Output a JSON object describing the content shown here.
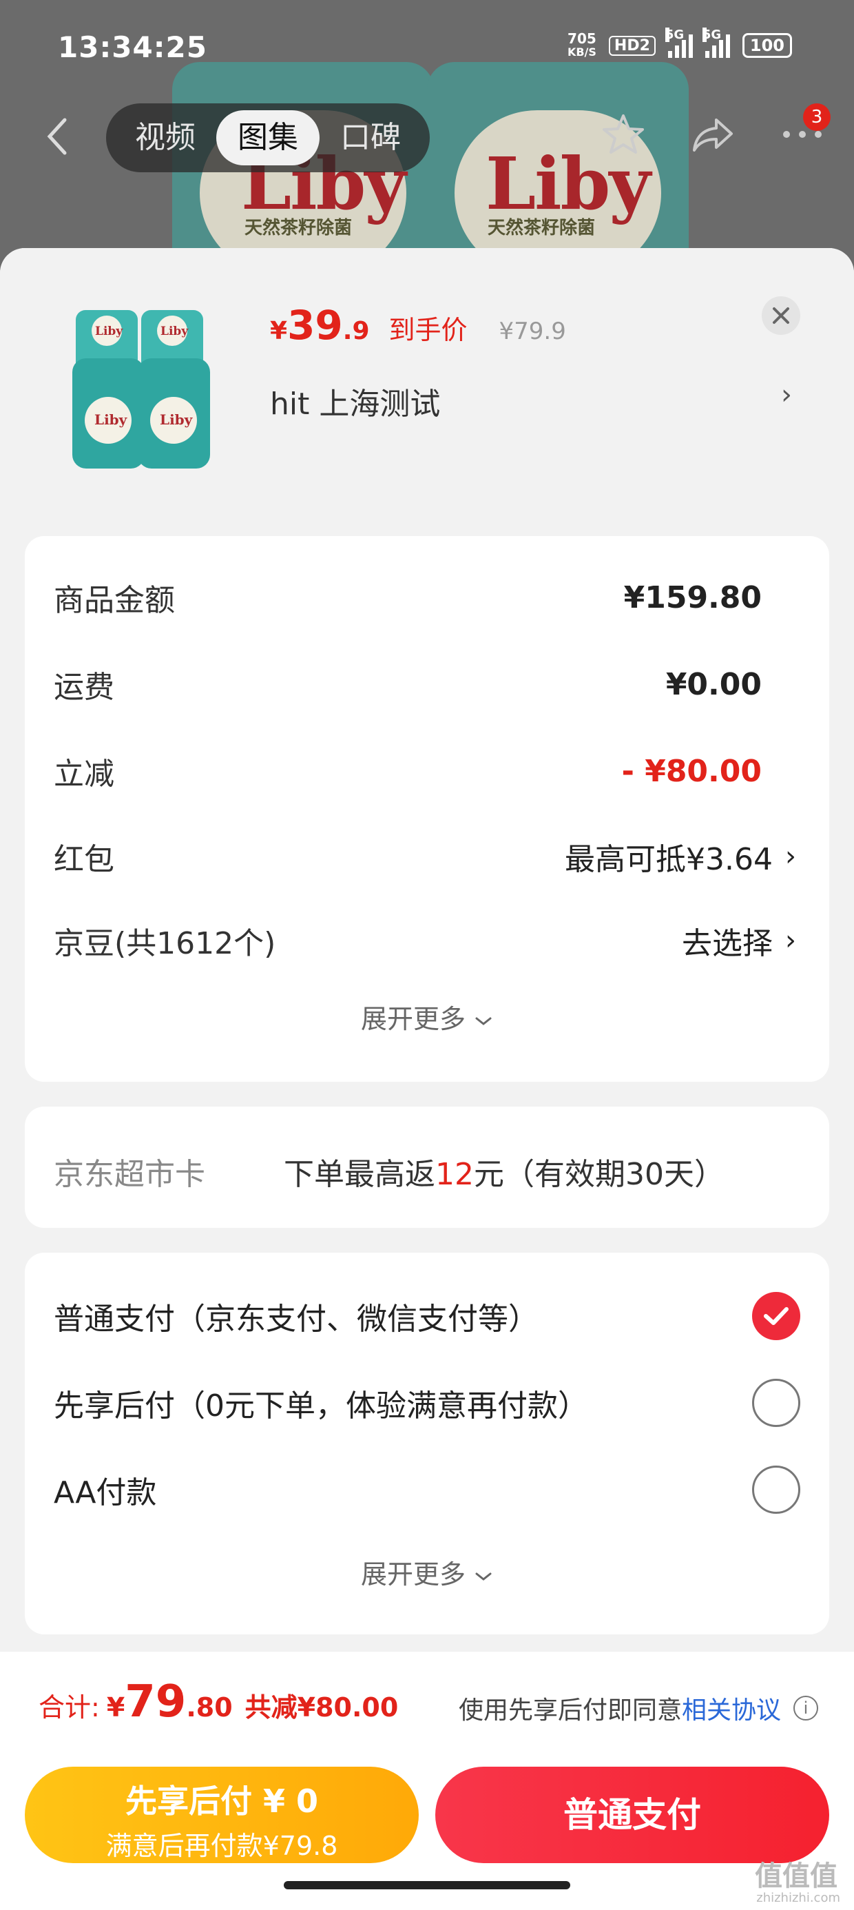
{
  "status_bar": {
    "time": "13:34:25",
    "net_speed_value": "705",
    "net_speed_unit": "KB/S",
    "hd_label": "HD2",
    "sim1_label": "5G",
    "sim2_label": "5G",
    "battery": "100"
  },
  "nav": {
    "tabs": [
      {
        "label": "视频",
        "active": false
      },
      {
        "label": "图集",
        "active": true
      },
      {
        "label": "口碑",
        "active": false
      }
    ],
    "more_badge": "3"
  },
  "product_bg": {
    "brand": "Liby",
    "sub": "天然茶籽除菌"
  },
  "product": {
    "price_symbol": "¥",
    "price_int": "39",
    "price_dec": ".9",
    "price_label": "到手价",
    "original_price": "¥79.9",
    "spec": "hit  上海测试",
    "spec_arrow": "›"
  },
  "fees": {
    "rows": [
      {
        "label": "商品金额",
        "value": "¥159.80"
      },
      {
        "label": "运费",
        "value": "¥0.00"
      },
      {
        "label": "立减",
        "value": "- ¥80.00"
      },
      {
        "label": "红包",
        "value": "最高可抵¥3.64"
      },
      {
        "label": "京豆(共1612个)",
        "value": "去选择"
      }
    ],
    "arrow": "›",
    "expand_label": "展开更多"
  },
  "jd_card": {
    "label": "京东超市卡",
    "text_before": "下单最高返",
    "highlight": "12",
    "text_after": "元（有效期30天）"
  },
  "payment": {
    "options": [
      {
        "label": "普通支付（京东支付、微信支付等）",
        "selected": true
      },
      {
        "label": "先享后付（0元下单，体验满意再付款）",
        "selected": false
      },
      {
        "label": "AA付款",
        "selected": false
      }
    ],
    "expand_label": "展开更多"
  },
  "total": {
    "label": "合计:",
    "symbol": "¥",
    "int": "79",
    "dec": ".80",
    "saving": "共减¥80.00",
    "agree_text": "使用先享后付即同意",
    "agree_link": "相关协议",
    "info_glyph": "i"
  },
  "buttons": {
    "later_line1": "先享后付 ¥ 0",
    "later_line2": "满意后再付款¥79.8",
    "normal_label": "普通支付"
  },
  "watermark": {
    "main": "值值值",
    "sub": "zhizhizhi.com"
  },
  "colors": {
    "accent_red": "#e2231a",
    "link_blue": "#2a68d8",
    "later_yellow": "#ffb30f"
  }
}
